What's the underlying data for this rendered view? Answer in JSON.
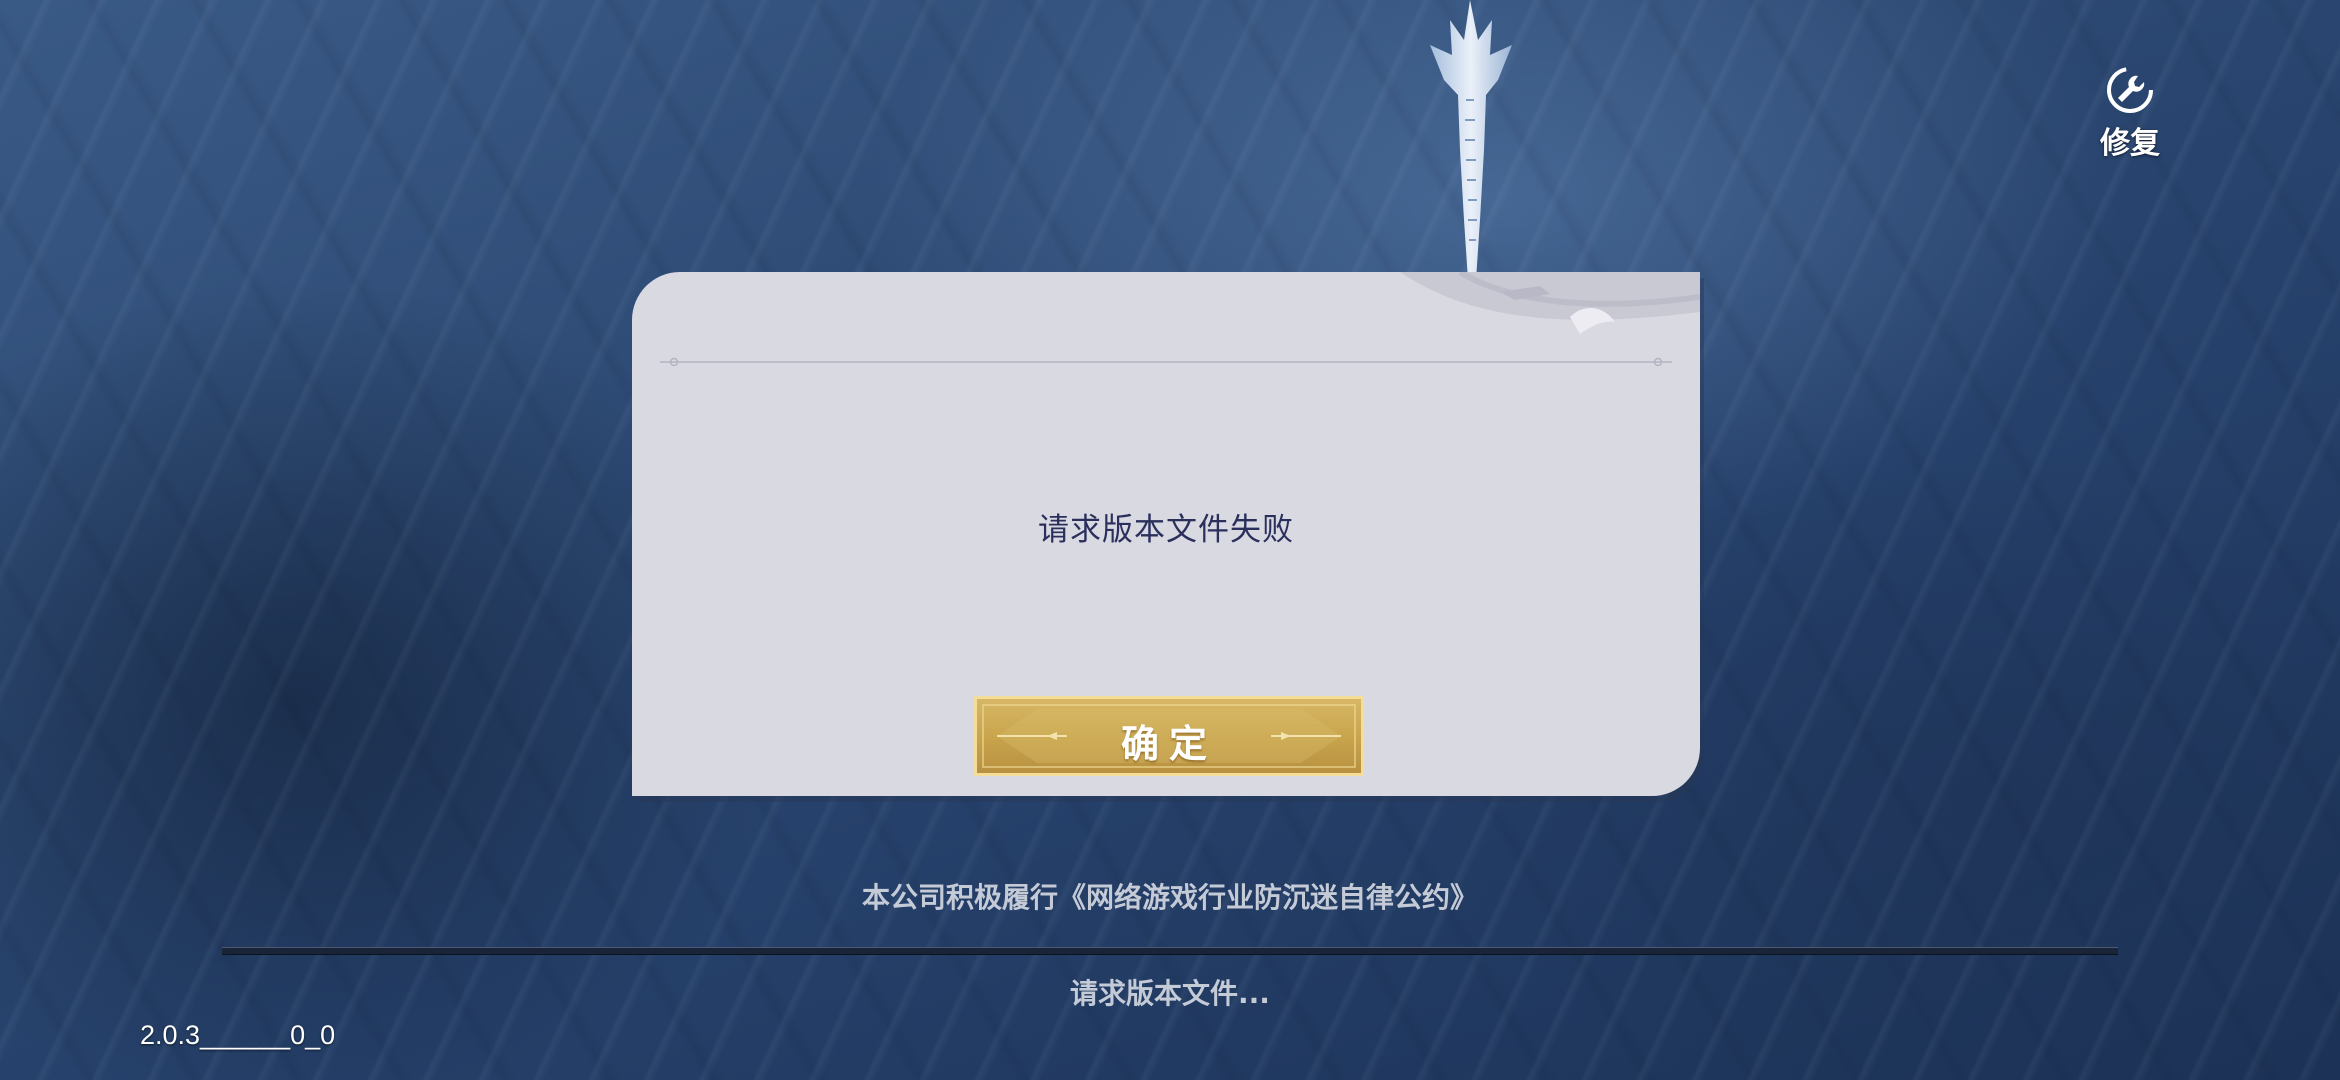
{
  "repair": {
    "label": "修复",
    "icon": "wrench-repair-icon"
  },
  "dialog": {
    "message": "请求版本文件失败",
    "confirm_label": "确定"
  },
  "footer": {
    "notice": "本公司积极履行《网络游戏行业防沉迷自律公约》",
    "status": "请求版本文件...",
    "progress_fraction": 0,
    "version": "2.0.3______0_0"
  },
  "colors": {
    "dialog_bg": "#d9d9e2",
    "message_text": "#2a2f5c",
    "button_gold": "#c9a54d",
    "button_border": "#f3dd98"
  }
}
